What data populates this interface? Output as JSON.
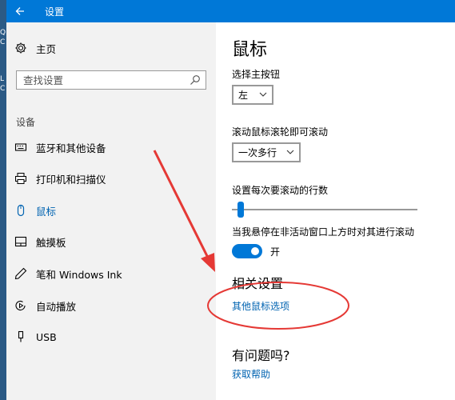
{
  "window": {
    "title": "设置"
  },
  "desktop_fragments": [
    "Q",
    "C",
    "L",
    "C"
  ],
  "sidebar": {
    "home_label": "主页",
    "search_placeholder": "查找设置",
    "section_label": "设备",
    "items": [
      {
        "label": "蓝牙和其他设备",
        "icon": "keyboard-icon"
      },
      {
        "label": "打印机和扫描仪",
        "icon": "printer-icon"
      },
      {
        "label": "鼠标",
        "icon": "mouse-icon",
        "active": true
      },
      {
        "label": "触摸板",
        "icon": "touchpad-icon"
      },
      {
        "label": "笔和 Windows Ink",
        "icon": "pen-icon"
      },
      {
        "label": "自动播放",
        "icon": "autoplay-icon"
      },
      {
        "label": "USB",
        "icon": "usb-icon"
      }
    ]
  },
  "main": {
    "title": "鼠标",
    "primary_button": {
      "label": "选择主按钮",
      "value": "左"
    },
    "scroll_wheel": {
      "label": "滚动鼠标滚轮即可滚动",
      "value": "一次多行"
    },
    "lines_to_scroll": {
      "label": "设置每次要滚动的行数",
      "level_percent": 3
    },
    "inactive_scroll": {
      "label": "当我悬停在非活动窗口上方时对其进行滚动",
      "state_label": "开",
      "on": true
    },
    "related": {
      "heading": "相关设置",
      "link": "其他鼠标选项"
    },
    "help": {
      "heading": "有问题吗?",
      "link": "获取帮助"
    }
  },
  "colors": {
    "accent": "#0078d7",
    "link": "#0063b1",
    "annotation": "#e53935",
    "sidebar_bg": "#f2f2f2"
  }
}
